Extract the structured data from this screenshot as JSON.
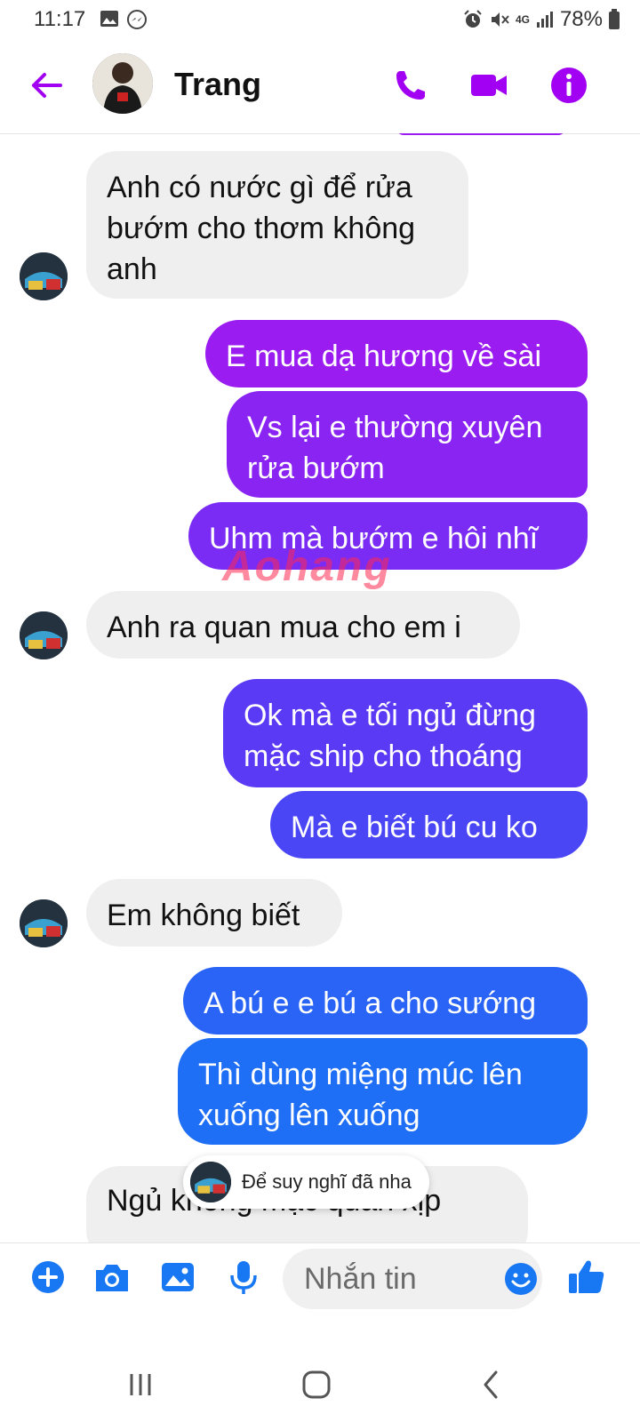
{
  "status_bar": {
    "time": "11:17",
    "network": "4G",
    "battery": "78%"
  },
  "header": {
    "contact_name": "Trang"
  },
  "messages": [
    {
      "side": "received",
      "text": "Anh có nước gì để rửa bướm cho thơm không anh"
    },
    {
      "side": "sent",
      "text": "E mua dạ hương về sài"
    },
    {
      "side": "sent",
      "text": "Vs lại e thường xuyên rửa bướm"
    },
    {
      "side": "sent",
      "text": "Uhm mà bướm e hôi nhĩ"
    },
    {
      "side": "received",
      "text": "Anh ra quan mua cho em i"
    },
    {
      "side": "sent",
      "text": "Ok mà e tối ngủ đừng mặc ship cho thoáng"
    },
    {
      "side": "sent",
      "text": "Mà e biết bú cu ko"
    },
    {
      "side": "received",
      "text": "Em không biết"
    },
    {
      "side": "sent",
      "text": "A bú e e bú a cho sướng"
    },
    {
      "side": "sent",
      "text": "Thì dùng miệng múc lên xuống lên xuống"
    },
    {
      "side": "received",
      "text": "Ngủ không mặc quần xịp"
    }
  ],
  "reaction_pill": {
    "text": "Để suy nghĩ đã nha"
  },
  "watermark": "Aohang",
  "composer": {
    "placeholder": "Nhắn tin"
  },
  "colors": {
    "accent_purple": "#a100f2",
    "sent_purple": "#9b1cf0",
    "sent_violet": "#6a2ff5",
    "sent_indigo": "#4a46f6",
    "sent_blue": "#1f6ef6",
    "received_bg": "#efefef",
    "icon_blue": "#1877f2"
  }
}
